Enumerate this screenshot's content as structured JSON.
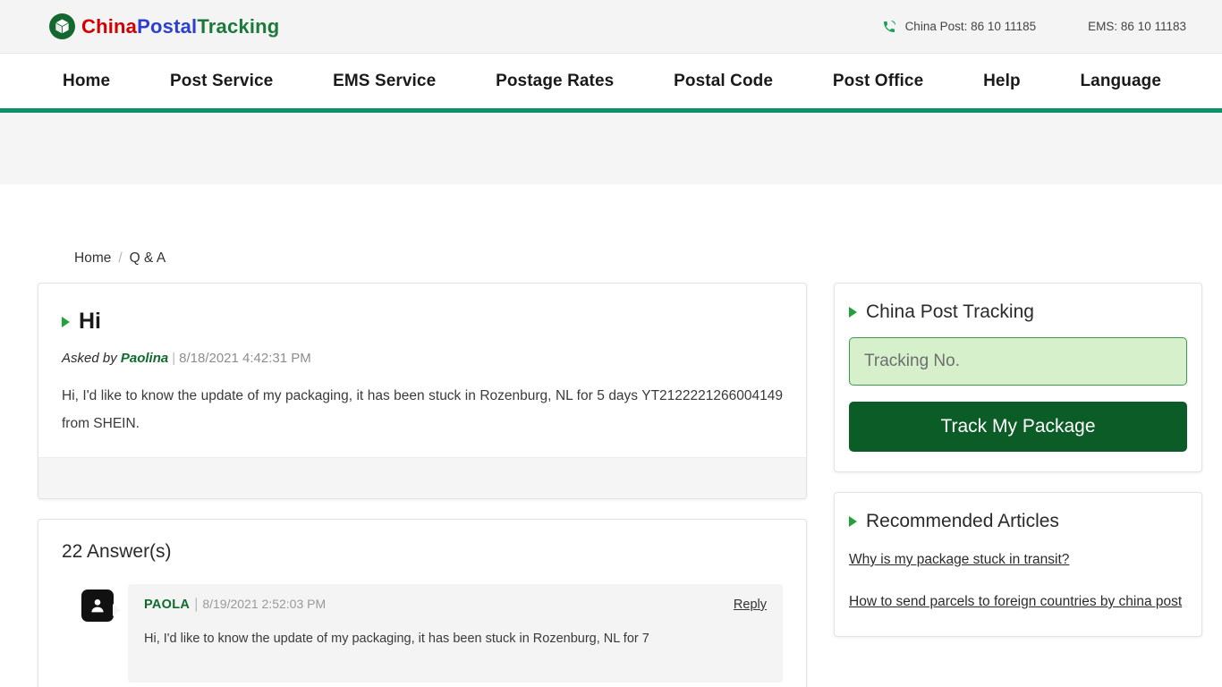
{
  "header": {
    "logo": {
      "icon": "package-box-icon",
      "part1": "China",
      "part2": "Postal",
      "part3": "Tracking"
    },
    "phone_icon": "phone-icon",
    "china_post_phone": "China Post: 86 10 11185",
    "ems_phone": "EMS: 86 10 11183"
  },
  "nav": {
    "items": [
      {
        "label": "Home"
      },
      {
        "label": "Post Service"
      },
      {
        "label": "EMS Service"
      },
      {
        "label": "Postage Rates"
      },
      {
        "label": "Postal Code"
      },
      {
        "label": "Post Office"
      },
      {
        "label": "Help"
      },
      {
        "label": "Language"
      }
    ]
  },
  "breadcrumb": {
    "home": "Home",
    "separator": "/",
    "current": "Q & A"
  },
  "question": {
    "title": "Hi",
    "asked_by_label": "Asked by",
    "author": "Paolina",
    "separator": "|",
    "date": "8/18/2021 4:42:31 PM",
    "body": "Hi, I'd like to know the update of my packaging, it has been stuck in Rozenburg, NL for 5 days YT2122221266004149 from SHEIN."
  },
  "answers": {
    "count_label": "22 Answer(s)",
    "items": [
      {
        "avatar_icon": "user-avatar-icon",
        "name": "PAOLA",
        "separator": "|",
        "date": "8/19/2021 2:52:03 PM",
        "reply_label": "Reply",
        "text": "Hi, I'd like to know the update of my packaging, it has been stuck in Rozenburg, NL for 7"
      }
    ]
  },
  "sidebar": {
    "tracking": {
      "title": "China Post Tracking",
      "input_value": "",
      "input_placeholder": "Tracking No.",
      "button_label": "Track My Package"
    },
    "articles": {
      "title": "Recommended Articles",
      "links": [
        {
          "label": "Why is my package stuck in transit?"
        },
        {
          "label": "How to send parcels to foreign countries by china post"
        }
      ]
    }
  },
  "colors": {
    "accent_green": "#0d8f67",
    "brand_dark_green": "#0b5c26",
    "bullet_green": "#22a03a",
    "logo_red": "#d40000",
    "logo_blue": "#2b3fd0",
    "logo_green": "#1b7a3a",
    "input_bg": "#d6f0cb",
    "banner_bg": "#f5f5f5"
  }
}
